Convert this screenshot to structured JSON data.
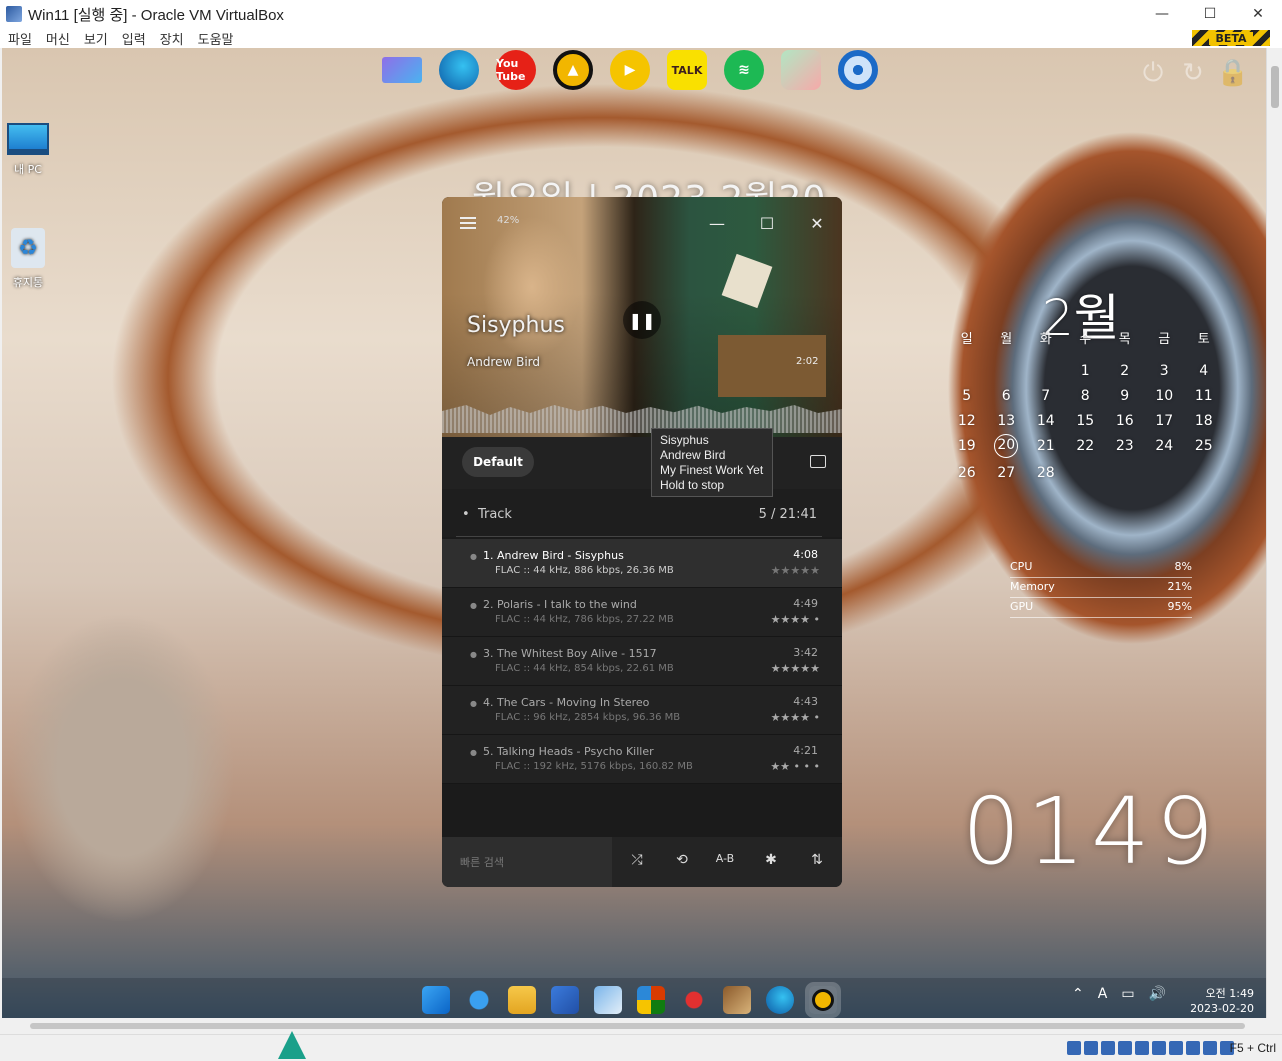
{
  "window": {
    "title": "Win11 [실행 중] - Oracle VM VirtualBox",
    "minimize": "—",
    "maximize": "☐",
    "close": "✕"
  },
  "menu": [
    "파일",
    "머신",
    "보기",
    "입력",
    "장치",
    "도움말"
  ],
  "beta_badge": "BETA",
  "dock": {
    "icons": [
      "monitor-icon",
      "edge-icon",
      "youtube-icon",
      "aimp-icon",
      "player-icon",
      "kakaotalk-icon",
      "spotify-icon",
      "photos-icon",
      "settings-icon"
    ],
    "youtube_label": "You Tube",
    "talk_label": "TALK"
  },
  "desktop_icons": [
    {
      "label": "내 PC"
    },
    {
      "label": "휴지통"
    }
  ],
  "big_date": "월요일  |  2023 2월20",
  "calendar": {
    "month": "2월",
    "weekdays": [
      "일",
      "월",
      "화",
      "수",
      "목",
      "금",
      "토"
    ],
    "days": [
      "",
      "",
      "",
      "1",
      "2",
      "3",
      "4",
      "5",
      "6",
      "7",
      "8",
      "9",
      "10",
      "11",
      "12",
      "13",
      "14",
      "15",
      "16",
      "17",
      "18",
      "19",
      "20",
      "21",
      "22",
      "23",
      "24",
      "25",
      "26",
      "27",
      "28"
    ],
    "today": "20"
  },
  "stats": [
    {
      "label": "CPU",
      "value": "8%"
    },
    {
      "label": "Memory",
      "value": "21%"
    },
    {
      "label": "GPU",
      "value": "95%"
    }
  ],
  "clock": "0149",
  "player": {
    "volume": "42%",
    "title": "Sisyphus",
    "artist": "Andrew Bird",
    "elapsed": "2:02",
    "preset": "Default",
    "track_label": "Track",
    "track_count": "5 / 21:41",
    "tooltip": [
      "Sisyphus",
      "Andrew Bird",
      "My Finest Work Yet",
      "Hold to stop"
    ],
    "search_placeholder": "빠른 검색",
    "ab_label": "A-B",
    "tracks": [
      {
        "title": "1. Andrew Bird - Sisyphus",
        "info": "FLAC :: 44 kHz, 886 kbps, 26.36 MB",
        "duration": "4:08",
        "stars": "★★★★★",
        "rating": 0
      },
      {
        "title": "2. Polaris - I talk to the wind",
        "info": "FLAC :: 44 kHz, 786 kbps, 27.22 MB",
        "duration": "4:49",
        "stars": "★★★★ •",
        "rating": 4
      },
      {
        "title": "3. The Whitest Boy Alive - 1517",
        "info": "FLAC :: 44 kHz, 854 kbps, 22.61 MB",
        "duration": "3:42",
        "stars": "★★★★★",
        "rating": 5
      },
      {
        "title": "4. The Cars - Moving In Stereo",
        "info": "FLAC :: 96 kHz, 2854 kbps, 96.36 MB",
        "duration": "4:43",
        "stars": "★★★★ •",
        "rating": 4
      },
      {
        "title": "5. Talking Heads - Psycho Killer",
        "info": "FLAC :: 192 kHz, 5176 kbps, 160.82 MB",
        "duration": "4:21",
        "stars": "★★ • • •",
        "rating": 2
      }
    ]
  },
  "taskbar": {
    "apps": [
      "start-icon",
      "search-icon",
      "file-explorer-icon",
      "store-icon",
      "control-panel-icon",
      "office-icon",
      "ccleaner-icon",
      "winrar-icon",
      "edge-icon",
      "aimp-icon"
    ],
    "time": "오전 1:49",
    "date": "2023-02-20",
    "ime": "A"
  },
  "status": {
    "host_key": "F5 + Ctrl"
  },
  "colors": {
    "accent": "#2b86d8",
    "player_bg": "#1b1b1b",
    "aimp_yellow": "#f2b600"
  }
}
